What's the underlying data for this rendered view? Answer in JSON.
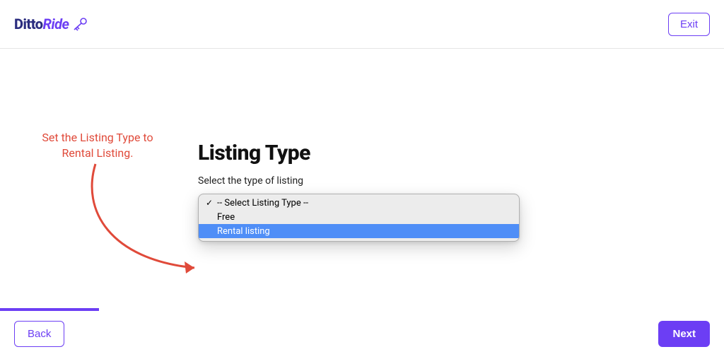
{
  "brand": {
    "part1": "Ditto",
    "part2": "Ride"
  },
  "header": {
    "exit_label": "Exit"
  },
  "instruction": "Set the Listing Type to Rental Listing.",
  "form": {
    "title": "Listing Type",
    "subtitle": "Select the type of listing",
    "options": [
      {
        "label": "-- Select Listing Type --",
        "selected": true,
        "highlighted": false
      },
      {
        "label": "Free",
        "selected": false,
        "highlighted": false
      },
      {
        "label": "Rental listing",
        "selected": false,
        "highlighted": true
      }
    ]
  },
  "footer": {
    "back_label": "Back",
    "next_label": "Next"
  },
  "colors": {
    "accent": "#6c3ef4",
    "instruction": "#e04a3a",
    "highlight": "#4f8ef7"
  }
}
